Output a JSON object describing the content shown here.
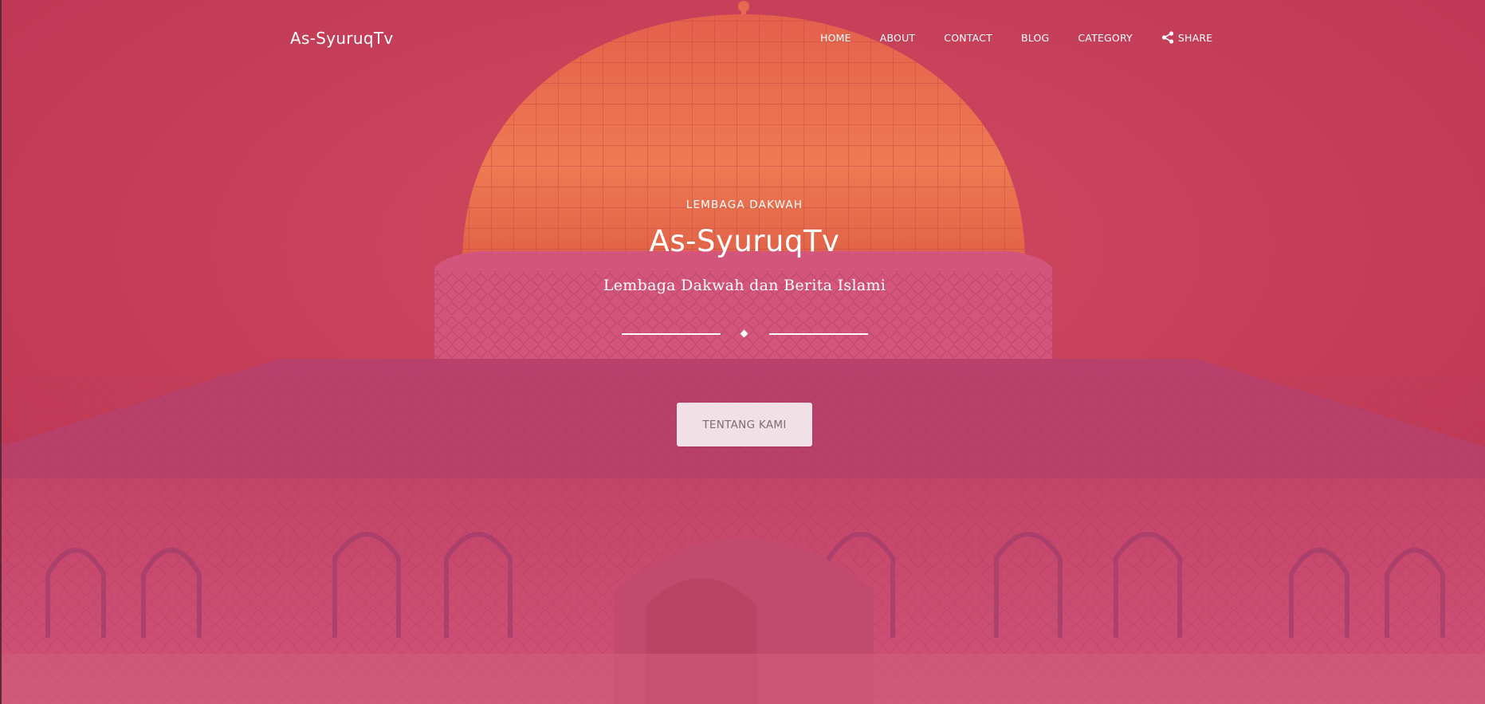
{
  "colors": {
    "overlay": "#c63a57",
    "dome": "#e8614e",
    "text": "#ffffff",
    "button_bg": "#f5eef0",
    "button_text": "#7d6e73"
  },
  "nav": {
    "brand": "As-SyuruqTv",
    "items": [
      {
        "label": "HOME"
      },
      {
        "label": "ABOUT"
      },
      {
        "label": "CONTACT"
      },
      {
        "label": "BLOG"
      },
      {
        "label": "CATEGORY"
      },
      {
        "label": "SHARE",
        "icon": "share-icon"
      }
    ]
  },
  "hero": {
    "eyebrow": "LEMBAGA DAKWAH",
    "title": "As-SyuruqTv",
    "subtitle": "Lembaga Dakwah dan Berita Islami",
    "button_label": "TENTANG KAMI",
    "background": "dome-of-the-rock-image"
  }
}
